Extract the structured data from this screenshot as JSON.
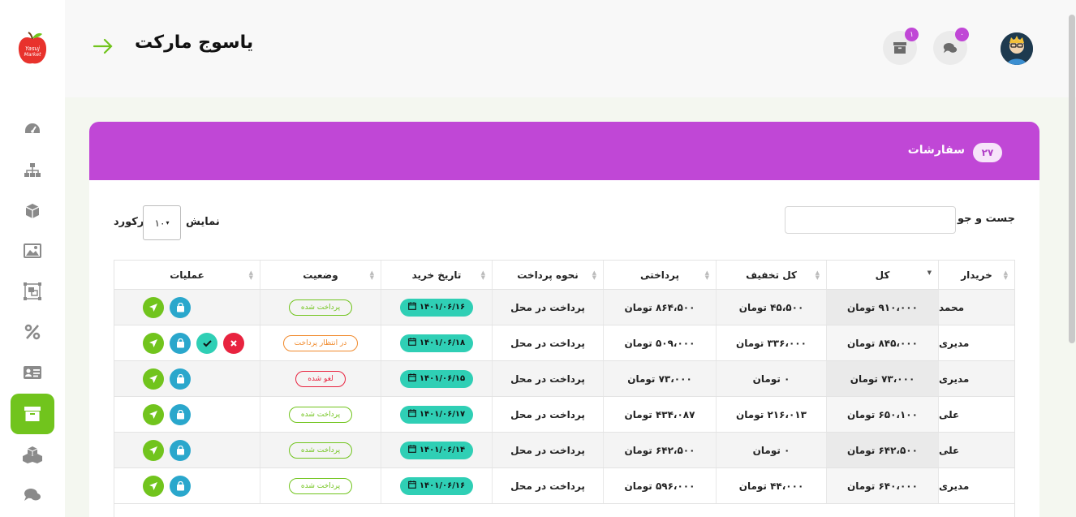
{
  "header": {
    "title": "یاسوج مارکت",
    "messages_badge": "۰",
    "orders_badge": "۱"
  },
  "logo": {
    "text": "Yasuj Market"
  },
  "card": {
    "title": "سفارشات",
    "count": "۲۷"
  },
  "controls": {
    "search_label": "جست و جو :",
    "search_value": "",
    "show_label": "نمایش",
    "records_label": "رکورد",
    "page_length": "۱۰"
  },
  "columns": [
    "خریدار",
    "کل",
    "کل تخفیف",
    "پرداختی",
    "نحوه پرداخت",
    "تاریخ خرید",
    "وضعیت",
    "عملیات"
  ],
  "rows": [
    {
      "buyer": "محمد",
      "total": "۹۱۰،۰۰۰ تومان",
      "discount": "۴۵،۵۰۰ تومان",
      "paid": "۸۶۴،۵۰۰ تومان",
      "method": "پرداخت در محل",
      "date": "۱۴۰۱/۰۶/۱۶",
      "status": "پرداخت شده",
      "status_type": "paid",
      "ops": [
        "cart",
        "send"
      ]
    },
    {
      "buyer": "مدیری",
      "total": "۸۴۵،۰۰۰ تومان",
      "discount": "۳۳۶،۰۰۰ تومان",
      "paid": "۵۰۹،۰۰۰ تومان",
      "method": "پرداخت در محل",
      "date": "۱۴۰۱/۰۶/۱۸",
      "status": "در انتظار پرداخت",
      "status_type": "pending",
      "ops": [
        "cancel",
        "check",
        "cart",
        "send"
      ]
    },
    {
      "buyer": "مدیری",
      "total": "۷۳،۰۰۰ تومان",
      "discount": "۰ تومان",
      "paid": "۷۳،۰۰۰ تومان",
      "method": "پرداخت در محل",
      "date": "۱۴۰۱/۰۶/۱۵",
      "status": "لغو شده",
      "status_type": "cancel",
      "ops": [
        "cart",
        "send"
      ]
    },
    {
      "buyer": "علی",
      "total": "۶۵۰،۱۰۰ تومان",
      "discount": "۲۱۶،۰۱۳ تومان",
      "paid": "۴۳۴،۰۸۷ تومان",
      "method": "پرداخت در محل",
      "date": "۱۴۰۱/۰۶/۱۷",
      "status": "پرداخت شده",
      "status_type": "paid",
      "ops": [
        "cart",
        "send"
      ]
    },
    {
      "buyer": "علی",
      "total": "۶۴۲،۵۰۰ تومان",
      "discount": "۰ تومان",
      "paid": "۶۴۲،۵۰۰ تومان",
      "method": "پرداخت در محل",
      "date": "۱۴۰۱/۰۶/۱۴",
      "status": "پرداخت شده",
      "status_type": "paid",
      "ops": [
        "cart",
        "send"
      ]
    },
    {
      "buyer": "مدیری",
      "total": "۶۴۰،۰۰۰ تومان",
      "discount": "۴۴،۰۰۰ تومان",
      "paid": "۵۹۶،۰۰۰ تومان",
      "method": "پرداخت در محل",
      "date": "۱۴۰۱/۰۶/۱۶",
      "status": "پرداخت شده",
      "status_type": "paid",
      "ops": [
        "cart",
        "send"
      ]
    }
  ],
  "colors": {
    "accent": "#c047d6",
    "green": "#71c41d",
    "teal": "#2fcfb5",
    "blue": "#2aa7cc",
    "red": "#e8233f",
    "orange": "#f0892b"
  }
}
